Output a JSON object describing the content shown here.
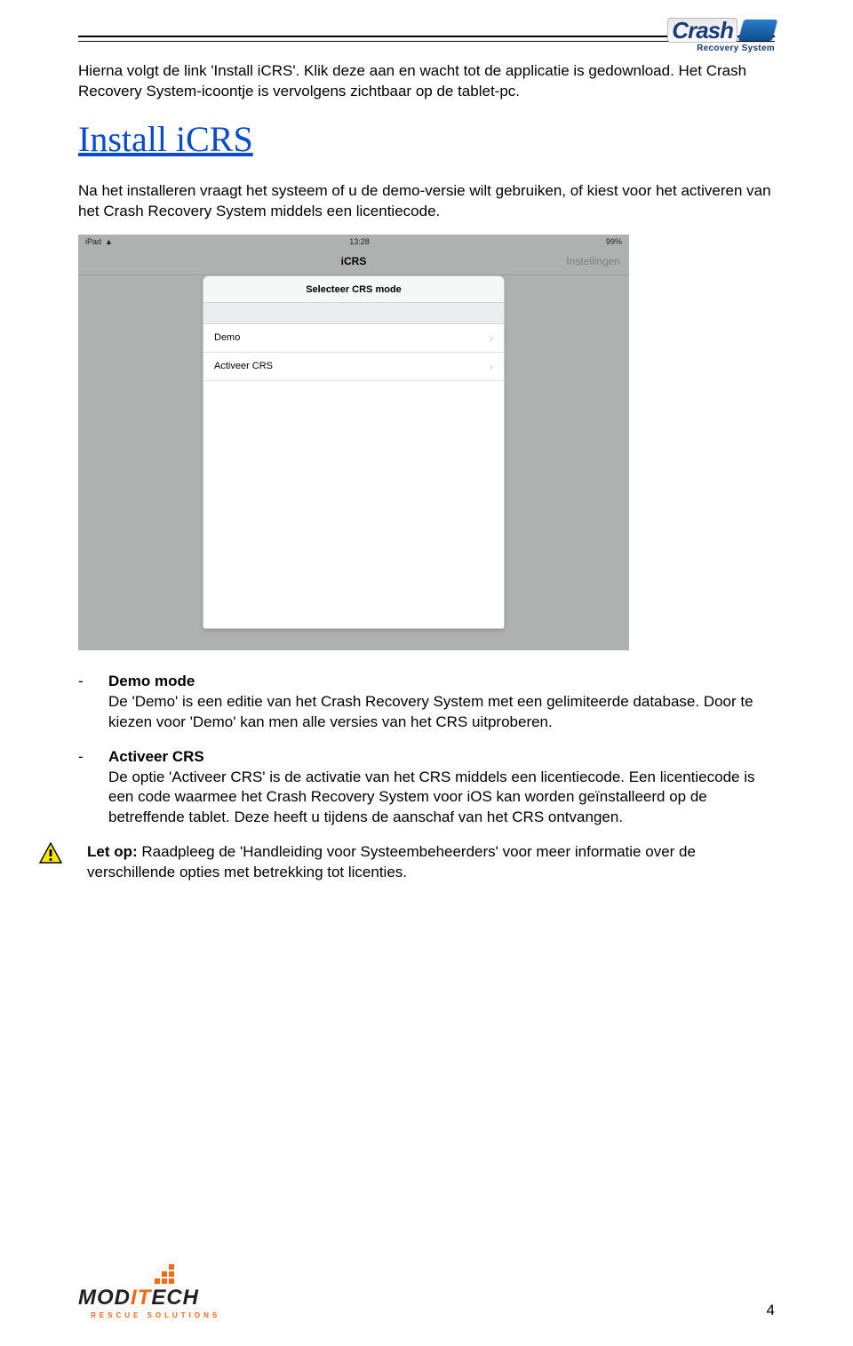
{
  "header_logo": {
    "brand": "Crash",
    "subtitle": "Recovery System"
  },
  "intro_text": "Hierna volgt de link 'Install iCRS'. Klik deze aan en wacht tot de applicatie is gedownload. Het Crash Recovery System-icoontje is vervolgens zichtbaar op de tablet-pc.",
  "install_link_label": "Install iCRS",
  "post_install_text": "Na het installeren vraagt het systeem of u de demo-versie wilt gebruiken, of kiest voor het activeren van het Crash Recovery System middels een licentiecode.",
  "ipad": {
    "status_left": "iPad",
    "status_time": "13:28",
    "status_batt": "99%",
    "title_center": "iCRS",
    "title_right": "Instellingen",
    "popup_header": "Selecteer CRS mode",
    "row1": "Demo",
    "row2": "Activeer CRS"
  },
  "bullets": {
    "b1_title": "Demo mode",
    "b1_body": "De 'Demo' is een editie van het Crash Recovery System met een gelimiteerde database. Door te kiezen voor 'Demo' kan men alle versies van het CRS uitproberen.",
    "b2_title": "Activeer CRS",
    "b2_body": "De optie 'Activeer CRS' is de activatie van het CRS middels een licentiecode. Een licentiecode is een code waarmee het Crash Recovery System voor iOS kan worden geïnstalleerd op de betreffende tablet. Deze heeft u tijdens de aanschaf van het CRS ontvangen."
  },
  "warning": {
    "label": "Let op:",
    "text": " Raadpleeg de 'Handleiding voor Systeembeheerders' voor meer informatie over de verschillende opties met betrekking tot licenties."
  },
  "footer_logo": {
    "name_pre": "MOD",
    "name_mid": "IT",
    "name_post": "ECH",
    "sub": "RESCUE SOLUTIONS"
  },
  "page_number": "4"
}
